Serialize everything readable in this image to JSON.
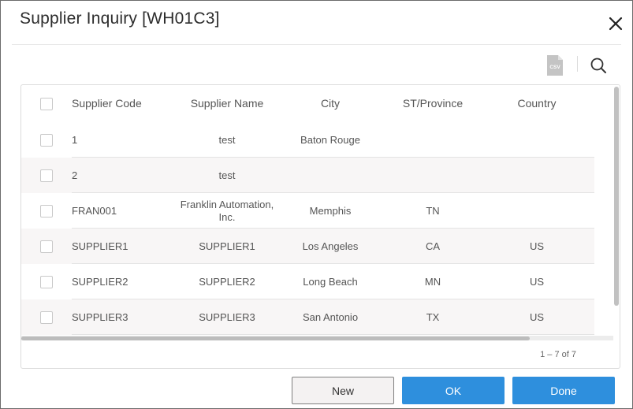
{
  "dialog": {
    "title": "Supplier Inquiry [WH01C3]",
    "close_icon": "close-icon"
  },
  "toolbar": {
    "csv_label": "CSV",
    "icons": [
      "csv-export-icon",
      "search-icon"
    ]
  },
  "table": {
    "columns": [
      "Supplier Code",
      "Supplier Name",
      "City",
      "ST/Province",
      "Country"
    ],
    "rows": [
      {
        "code": "1",
        "name": "test",
        "city": "Baton Rouge",
        "st": "",
        "country": ""
      },
      {
        "code": "2",
        "name": "test",
        "city": "",
        "st": "",
        "country": ""
      },
      {
        "code": "FRAN001",
        "name": "Franklin Automation, Inc.",
        "city": "Memphis",
        "st": "TN",
        "country": ""
      },
      {
        "code": "SUPPLIER1",
        "name": "SUPPLIER1",
        "city": "Los Angeles",
        "st": "CA",
        "country": "US"
      },
      {
        "code": "SUPPLIER2",
        "name": "SUPPLIER2",
        "city": "Long Beach",
        "st": "MN",
        "country": "US"
      },
      {
        "code": "SUPPLIER3",
        "name": "SUPPLIER3",
        "city": "San Antonio",
        "st": "TX",
        "country": "US"
      }
    ],
    "pager": "1 – 7 of 7"
  },
  "buttons": {
    "new": "New",
    "ok": "OK",
    "done": "Done"
  },
  "colors": {
    "primary": "#2e8fdd",
    "row_alt": "#f8f6f6",
    "border": "#6b6b6b"
  }
}
